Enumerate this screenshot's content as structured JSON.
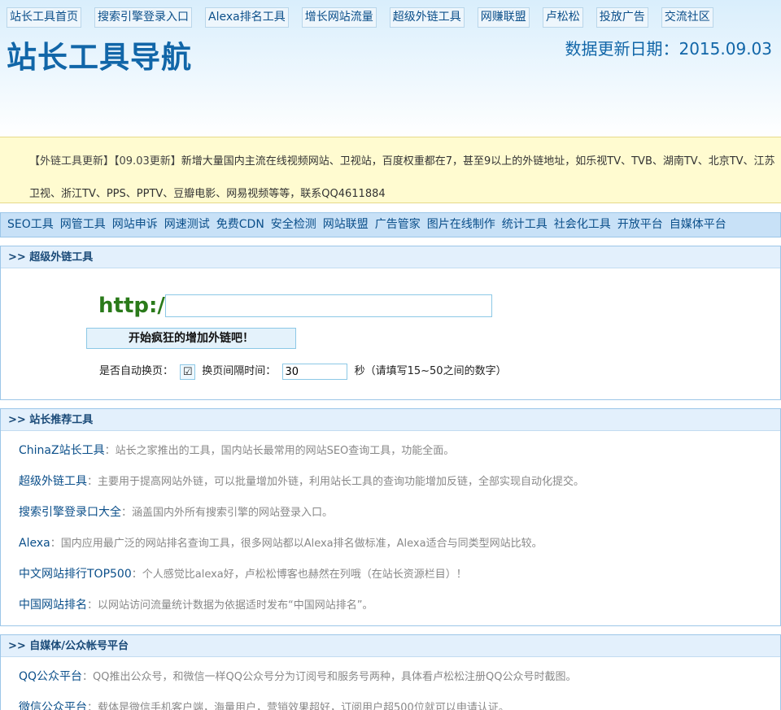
{
  "topnav": [
    "站长工具首页",
    "搜索引擎登录入口",
    "Alexa排名工具",
    "增长网站流量",
    "超级外链工具",
    "网赚联盟",
    "卢松松",
    "投放广告",
    "交流社区"
  ],
  "header": {
    "title": "站长工具导航",
    "update_date": "数据更新日期：2015.09.03"
  },
  "notice": {
    "tag1": "【外链工具更新】",
    "tag2": "【09.03更新】",
    "text": "新增大量国内主流在线视频网站、卫视站，百度权重都在7，甚至9以上的外链地址，如乐视TV、TVB、湖南TV、北京TV、江苏卫视、浙江TV、PPS、PPTV、豆瓣电影、网易视频等等，联系QQ4611884"
  },
  "categories": [
    "SEO工具",
    "网管工具",
    "网站申诉",
    "网速测试",
    "免费CDN",
    "安全检测",
    "网站联盟",
    "广告管家",
    "图片在线制作",
    "统计工具",
    "社会化工具",
    "开放平台",
    "自媒体平台"
  ],
  "tool_panel": {
    "heading": ">> 超级外链工具",
    "http_label": "http://",
    "url_value": "",
    "start_button": "开始疯狂的增加外链吧！",
    "auto_label": "是否自动换页：",
    "auto_checked": "☑",
    "interval_label": "换页间隔时间：",
    "interval_value": "30",
    "interval_hint": "秒（请填写15~50之间的数字）"
  },
  "recommend_panel": {
    "heading": ">> 站长推荐工具",
    "items": [
      {
        "title": "ChinaZ站长工具",
        "desc": "：站长之家推出的工具，国内站长最常用的网站SEO查询工具，功能全面。"
      },
      {
        "title": "超级外链工具",
        "desc": "：主要用于提高网站外链，可以批量增加外链，利用站长工具的查询功能增加反链，全部实现自动化提交。"
      },
      {
        "title": "搜索引擎登录口大全",
        "desc": "：涵盖国内外所有搜索引擎的网站登录入口。"
      },
      {
        "title": "Alexa",
        "desc": "：国内应用最广泛的网站排名查询工具，很多网站都以Alexa排名做标准，Alexa适合与同类型网站比较。"
      },
      {
        "title": "中文网站排行TOP500",
        "desc": "：个人感觉比alexa好，卢松松博客也赫然在列哦（在站长资源栏目）！"
      },
      {
        "title": "中国网站排名",
        "desc": "：以网站访问流量统计数据为依据适时发布“中国网站排名”。"
      }
    ]
  },
  "media_panel": {
    "heading": ">> 自媒体/公众帐号平台",
    "items": [
      {
        "title": "QQ公众平台",
        "desc": "：QQ推出公众号，和微信一样QQ公众号分为订阅号和服务号两种，具体看卢松松注册QQ公众号时截图。"
      },
      {
        "title": "微信公众平台",
        "desc": "：载体是微信手机客户端，海量用户，营销效果超好，订阅用户超500位就可以申请认证。"
      }
    ]
  }
}
